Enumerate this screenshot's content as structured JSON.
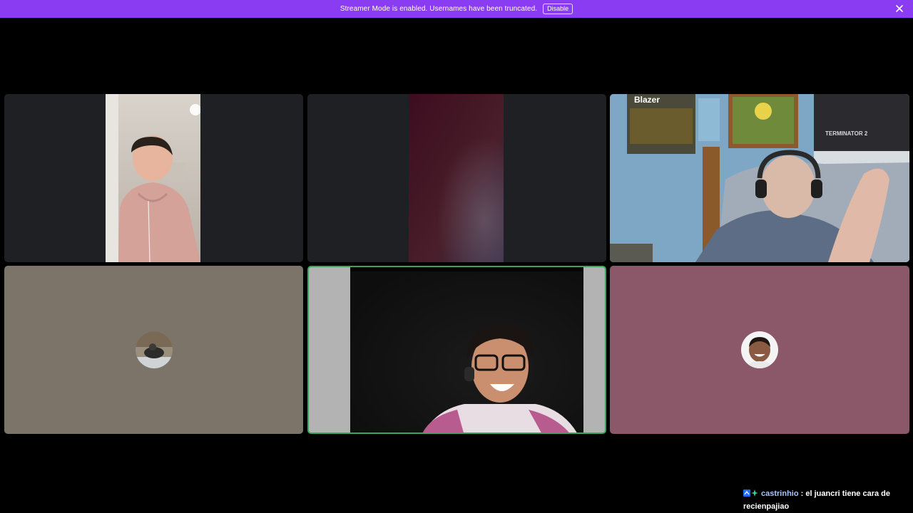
{
  "banner": {
    "message": "Streamer Mode is enabled. Usernames have been truncated.",
    "disable_label": "Disable",
    "bg_color": "#8a3cf2",
    "close_icon": "close-icon"
  },
  "stage": {
    "bg_color": "#000000",
    "tiles": [
      {
        "id": "tile-1",
        "type": "camera",
        "bg_color": "#1f2023"
      },
      {
        "id": "tile-2",
        "type": "camera",
        "bg_color": "#1f2023"
      },
      {
        "id": "tile-3",
        "type": "camera",
        "bg_color": "#6f9bb8"
      },
      {
        "id": "tile-4",
        "type": "avatar",
        "bg_color": "#7c7469",
        "avatar": "user-avatar"
      },
      {
        "id": "tile-5",
        "type": "camera",
        "bg_color": "#b3b3b3",
        "speaking": true,
        "speaking_color": "#3ba55d"
      },
      {
        "id": "tile-6",
        "type": "avatar",
        "bg_color": "#8a5868",
        "avatar": "user-avatar"
      }
    ]
  },
  "chat_overlay": {
    "badges": [
      "prime-badge-icon",
      "sparkle-badge-icon"
    ],
    "username": "castrinhio",
    "separator": ":",
    "message": "el juancri tiene cara de recienpajiao"
  }
}
